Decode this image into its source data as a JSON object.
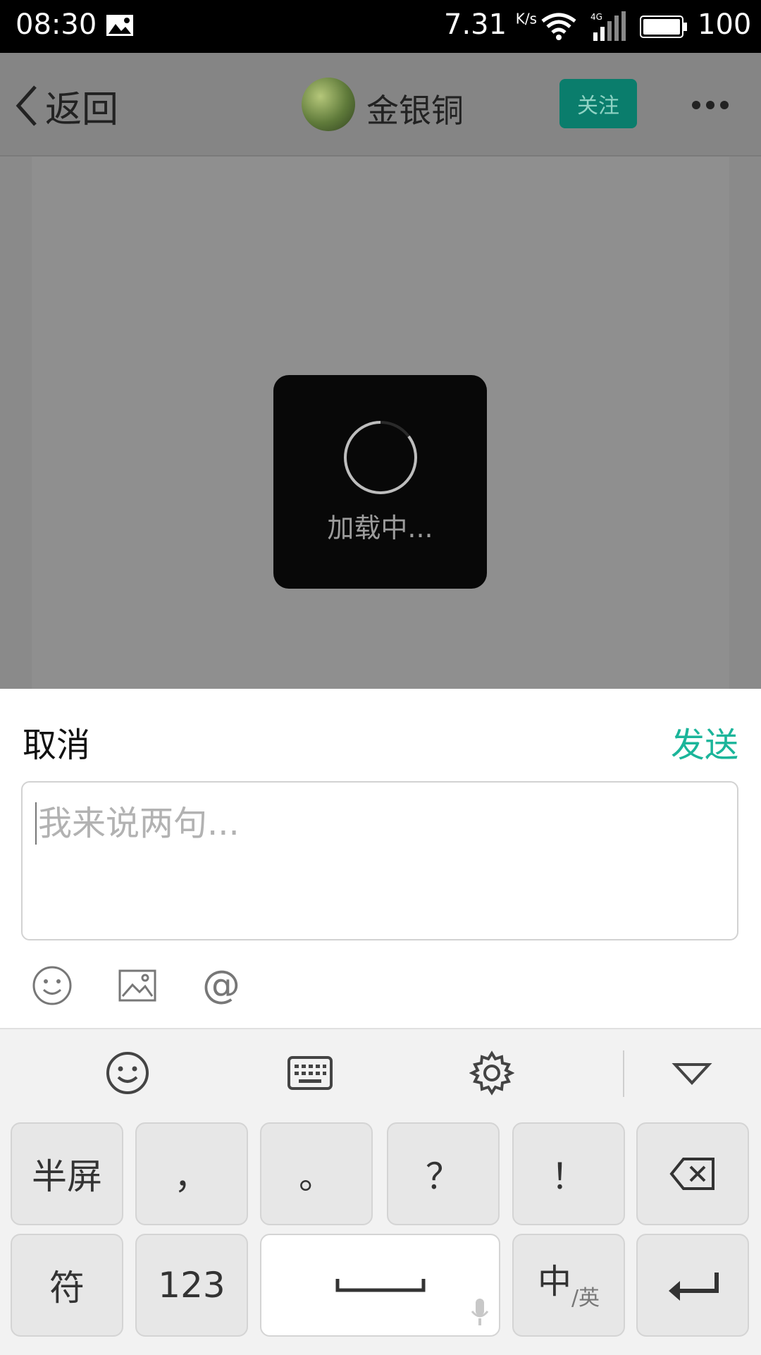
{
  "status_bar": {
    "time": "08:30",
    "net_speed": "7.31",
    "net_speed_unit": "K/s",
    "network_type": "4G",
    "battery_percent": "100",
    "icons": [
      "gallery-icon",
      "wifi-icon",
      "cellular-signal-icon",
      "battery-icon"
    ]
  },
  "header": {
    "back_label": "返回",
    "username": "金银铜",
    "follow_label": "关注",
    "more_icon": "more-dots-icon"
  },
  "loading": {
    "text": "加载中..."
  },
  "composer": {
    "cancel_label": "取消",
    "send_label": "发送",
    "input_placeholder": "我来说两句...",
    "input_value": "",
    "tools": [
      "emoji-icon",
      "image-icon",
      "at-mention-icon"
    ]
  },
  "keyboard": {
    "toolbar": [
      "emoji-icon",
      "keyboard-icon",
      "settings-gear-icon",
      "collapse-triangle-icon"
    ],
    "row1": [
      "半屏",
      "，",
      "。",
      "？",
      "！",
      "backspace-icon"
    ],
    "row2": [
      "符",
      "123",
      "space",
      "中/英",
      "enter-icon"
    ],
    "lang_main": "中",
    "lang_sub": "/英"
  },
  "colors": {
    "accent": "#1bb59a",
    "follow_bg": "#0a7d6c",
    "overlay": "#8a8a8a"
  }
}
